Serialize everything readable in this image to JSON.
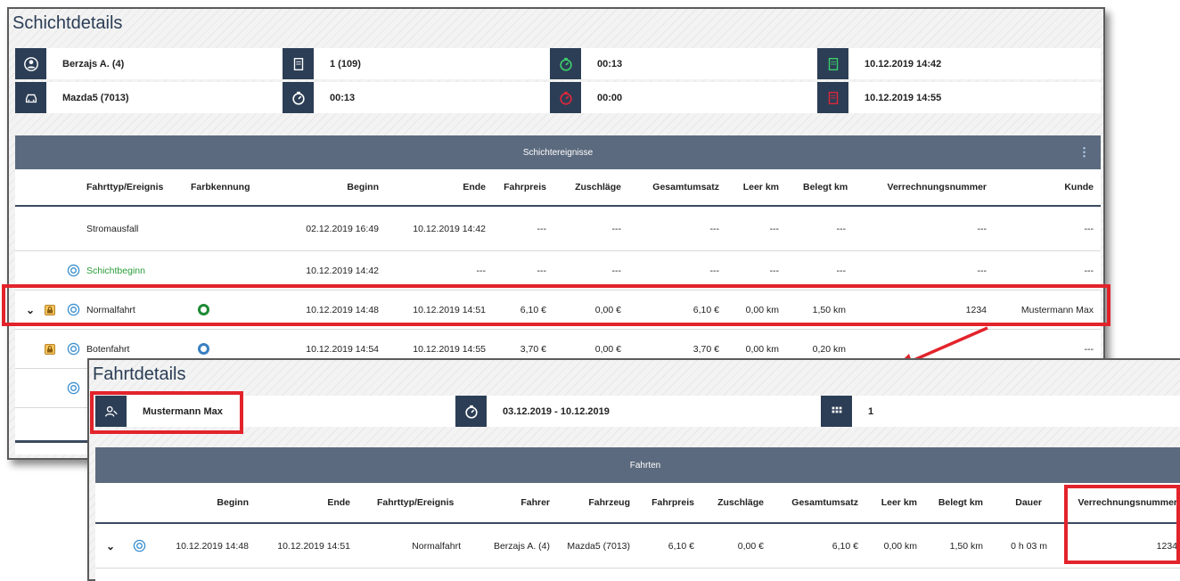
{
  "shift": {
    "title": "Schichtdetails",
    "info": [
      {
        "icon": "driver-icon",
        "value": "Berzajs A. (4)"
      },
      {
        "icon": "receipt-icon",
        "value": "1 (109)"
      },
      {
        "icon": "timer-green-icon",
        "value": "00:13"
      },
      {
        "icon": "shift-start-icon",
        "value": "10.12.2019 14:42"
      },
      {
        "icon": "car-icon",
        "value": "Mazda5 (7013)"
      },
      {
        "icon": "timer-icon",
        "value": "00:13"
      },
      {
        "icon": "timer-red-icon",
        "value": "00:00"
      },
      {
        "icon": "shift-end-icon",
        "value": "10.12.2019 14:55"
      }
    ],
    "panel_title": "Schichtereignisse",
    "columns": [
      "Fahrttyp/Ereignis",
      "Farbkennung",
      "Beginn",
      "Ende",
      "Fahrpreis",
      "Zuschläge",
      "Gesamtumsatz",
      "Leer km",
      "Belegt km",
      "Verrechnungsnummer",
      "Kunde"
    ],
    "rows": [
      {
        "type": "Stromausfall",
        "start": "02.12.2019 16:49",
        "end": "10.12.2019 14:42",
        "fare": "---",
        "extra": "---",
        "total": "---",
        "empty": "---",
        "occupied": "---",
        "billing": "---",
        "customer": "---"
      },
      {
        "type": "Schichtbeginn",
        "start": "10.12.2019 14:42",
        "end": "---",
        "fare": "---",
        "extra": "---",
        "total": "---",
        "empty": "---",
        "occupied": "---",
        "billing": "---",
        "customer": "---"
      },
      {
        "type": "Normalfahrt",
        "start": "10.12.2019 14:48",
        "end": "10.12.2019 14:51",
        "fare": "6,10 €",
        "extra": "0,00 €",
        "total": "6,10 €",
        "empty": "0,00 km",
        "occupied": "1,50 km",
        "billing": "1234",
        "customer": "Mustermann Max"
      },
      {
        "type": "Botenfahrt",
        "start": "10.12.2019 14:54",
        "end": "10.12.2019 14:55",
        "fare": "3,70 €",
        "extra": "0,00 €",
        "total": "3,70 €",
        "empty": "0,00 km",
        "occupied": "0,20 km",
        "billing": "",
        "customer": "---"
      }
    ]
  },
  "trip": {
    "title": "Fahrtdetails",
    "info": [
      {
        "icon": "customer-icon",
        "value": "Mustermann Max"
      },
      {
        "icon": "timer-icon",
        "value": "03.12.2019 - 10.12.2019"
      },
      {
        "icon": "grid-icon",
        "value": "1"
      }
    ],
    "panel_title": "Fahrten",
    "columns": [
      "Beginn",
      "Ende",
      "Fahrttyp/Ereignis",
      "Fahrer",
      "Fahrzeug",
      "Fahrpreis",
      "Zuschläge",
      "Gesamtumsatz",
      "Leer km",
      "Belegt km",
      "Dauer",
      "Verrechnungsnummer"
    ],
    "row": {
      "start": "10.12.2019 14:48",
      "end": "10.12.2019 14:51",
      "type": "Normalfahrt",
      "driver": "Berzajs A. (4)",
      "vehicle": "Mazda5 (7013)",
      "fare": "6,10 €",
      "extra": "0,00 €",
      "total": "6,10 €",
      "empty": "0,00 km",
      "occupied": "1,50 km",
      "duration": "0 h 03 m",
      "billing": "1234"
    }
  },
  "colors": {
    "accent": "#2c3e55",
    "highlight": "#e3232b",
    "green": "#2a9d3a",
    "red": "#e0263a",
    "panel": "#5b6a7e"
  }
}
